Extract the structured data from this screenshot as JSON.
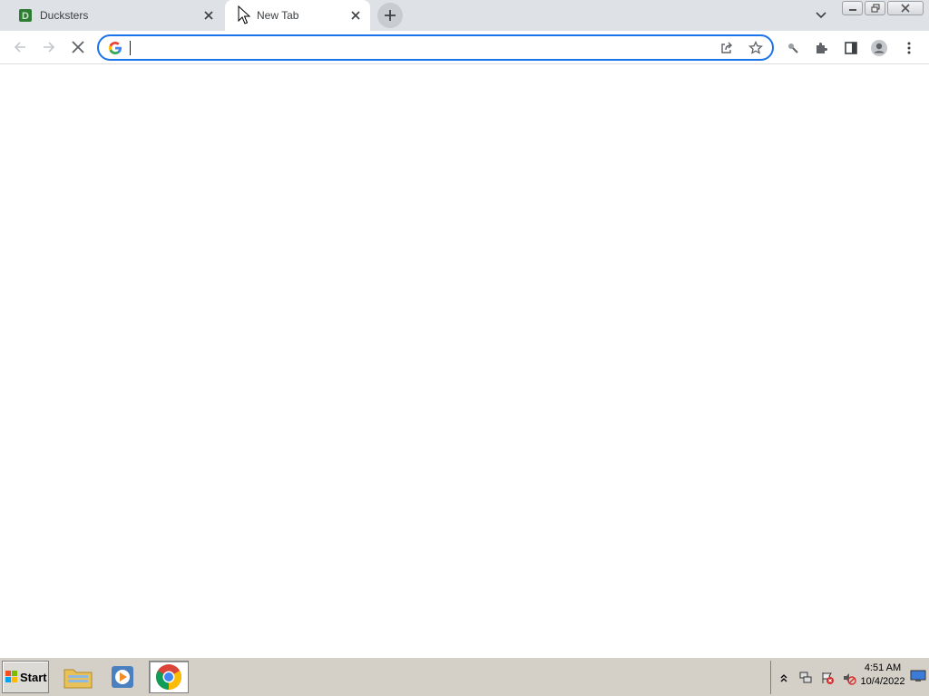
{
  "browser": {
    "tabs": [
      {
        "title": "Ducksters",
        "favicon_letter": "D",
        "active": false
      },
      {
        "title": "New Tab",
        "active": true
      }
    ],
    "omnibox": {
      "value": "",
      "placeholder": ""
    }
  },
  "taskbar": {
    "start_label": "Start",
    "clock": {
      "time": "4:51 AM",
      "date": "10/4/2022"
    },
    "apps": [
      {
        "icon": "folder-icon"
      },
      {
        "icon": "media-player-icon"
      },
      {
        "icon": "chrome-icon",
        "active": true
      }
    ]
  },
  "colors": {
    "accent": "#1a73e8",
    "tabstrip": "#dee1e6",
    "taskbar": "#d4d0c8",
    "ducksters_green": "#2e7d32"
  }
}
